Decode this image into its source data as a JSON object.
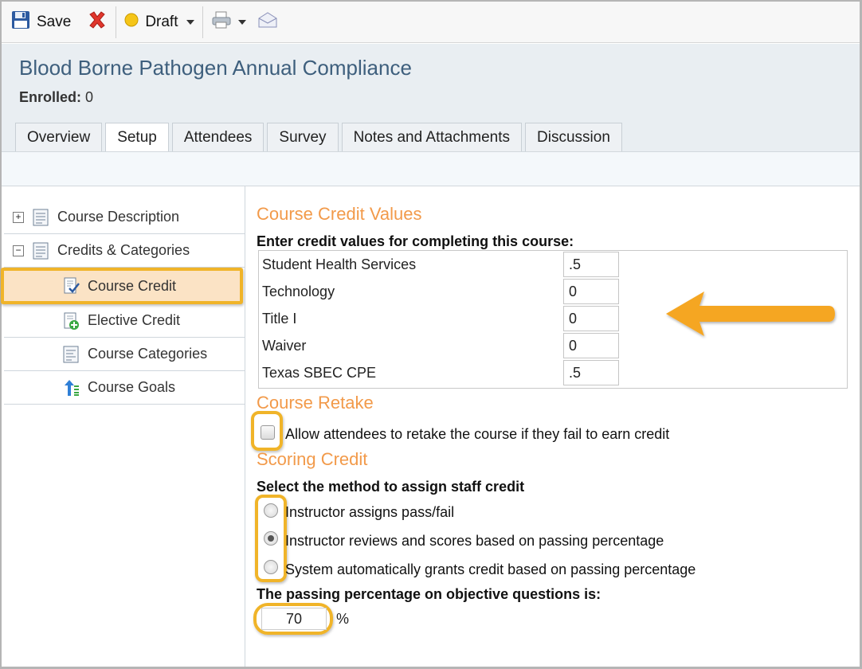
{
  "toolbar": {
    "save_label": "Save",
    "status_label": "Draft"
  },
  "header": {
    "title": "Blood Borne Pathogen Annual Compliance",
    "enrolled_label": "Enrolled:",
    "enrolled_value": "0"
  },
  "tabs": [
    "Overview",
    "Setup",
    "Attendees",
    "Survey",
    "Notes and Attachments",
    "Discussion"
  ],
  "tree": {
    "course_description": "Course Description",
    "credits_categories": "Credits & Categories",
    "course_credit": "Course Credit",
    "elective_credit": "Elective Credit",
    "course_categories": "Course Categories",
    "course_goals": "Course Goals"
  },
  "credit_values": {
    "title": "Course Credit Values",
    "instruction": "Enter credit values for completing this course:",
    "rows": [
      {
        "name": "Student Health Services",
        "value": ".5"
      },
      {
        "name": "Technology",
        "value": "0"
      },
      {
        "name": "Title I",
        "value": "0"
      },
      {
        "name": "Waiver",
        "value": "0"
      },
      {
        "name": "Texas SBEC CPE",
        "value": ".5"
      }
    ]
  },
  "retake": {
    "title": "Course Retake",
    "checkbox_label": "Allow attendees to retake the course if they fail to earn credit",
    "checked": false
  },
  "scoring": {
    "title": "Scoring Credit",
    "instruction": "Select the method to assign staff credit",
    "options": [
      "Instructor assigns pass/fail",
      "Instructor reviews and scores based on passing percentage",
      "System automatically grants credit based on passing percentage"
    ],
    "selected_index": 1,
    "passing_label": "The passing percentage on objective questions is:",
    "passing_value": "70",
    "percent_sign": "%"
  },
  "colors": {
    "accent_orange": "#f29a4a",
    "highlight": "#f0b429",
    "title_blue": "#3e5f7d"
  }
}
